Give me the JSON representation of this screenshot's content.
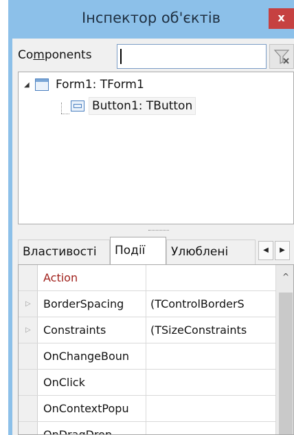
{
  "window": {
    "title": "Інспектор об'єктів",
    "close_label": "x",
    "colors": {
      "titlebar": "#8cc0e9",
      "close": "#c64141",
      "event_red": "#a0201b"
    }
  },
  "components": {
    "label_before": "Co",
    "label_underlined": "m",
    "label_after": "ponents",
    "search_value": "",
    "filter_icon": "funnel-clear-icon"
  },
  "tree": {
    "nodes": [
      {
        "label": "Form1: TForm1",
        "icon": "form-icon",
        "expanded": true
      },
      {
        "label": "Button1: TButton",
        "icon": "button-icon"
      }
    ]
  },
  "tabs": {
    "items": [
      {
        "label": "Властивості"
      },
      {
        "label": "Події",
        "active": true
      },
      {
        "label": "Улюблені"
      }
    ],
    "prev_icon": "chevron-left-icon",
    "next_icon": "chevron-right-icon"
  },
  "grid": {
    "rows": [
      {
        "name": "Action",
        "value": "",
        "expandable": false,
        "highlight": true
      },
      {
        "name": "BorderSpacing",
        "value": "(TControlBorderS",
        "expandable": true
      },
      {
        "name": "Constraints",
        "value": "(TSizeConstraints",
        "expandable": true
      },
      {
        "name": "OnChangeBoun",
        "value": ""
      },
      {
        "name": "OnClick",
        "value": ""
      },
      {
        "name": "OnContextPopu",
        "value": ""
      },
      {
        "name": "OnDragDrop",
        "value": ""
      }
    ]
  }
}
